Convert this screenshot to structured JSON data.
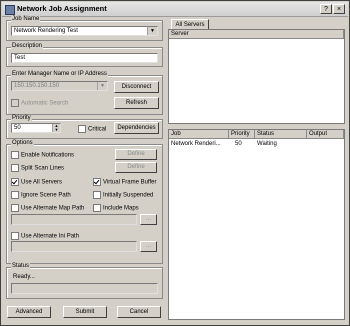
{
  "window": {
    "title": "Network Job Assignment",
    "help": "?",
    "close": "×"
  },
  "job_name": {
    "label": "Job Name",
    "value": "Network Rendering Test"
  },
  "description": {
    "label": "Description",
    "value": "Test"
  },
  "manager": {
    "label": "Enter Manager Name or IP Address",
    "value": "150.150.150.150",
    "autosearch_label": "Automatic Search",
    "disconnect_label": "Disconnect",
    "refresh_label": "Refresh"
  },
  "priority": {
    "label": "Priority",
    "value": "50",
    "critical_label": "Critical",
    "dependencies_label": "Dependencies"
  },
  "options": {
    "label": "Options",
    "enable_notifications": "Enable Notifications",
    "split_scan_lines": "Split Scan Lines",
    "use_all_servers": "Use All Servers",
    "virtual_frame_buffer": "Virtual Frame Buffer",
    "ignore_scene_path": "Ignore Scene Path",
    "initially_suspended": "Initially Suspended",
    "use_alternate_map_path": "Use Alternate Map Path",
    "include_maps": "Include Maps",
    "use_alternate_ini_path": "Use Alternate Ini Path",
    "define_label": "Define",
    "browse_label": "..."
  },
  "status": {
    "label": "Status",
    "value": "Ready..."
  },
  "buttons": {
    "advanced": "Advanced",
    "submit": "Submit",
    "cancel": "Cancel"
  },
  "servers": {
    "tab_label": "All Servers",
    "column": "Server"
  },
  "jobs": {
    "columns": [
      "Job",
      "Priority",
      "Status",
      "Output"
    ],
    "rows": [
      {
        "job": "Network Renderi...",
        "priority": "50",
        "status": "Waiting",
        "output": ""
      }
    ]
  }
}
